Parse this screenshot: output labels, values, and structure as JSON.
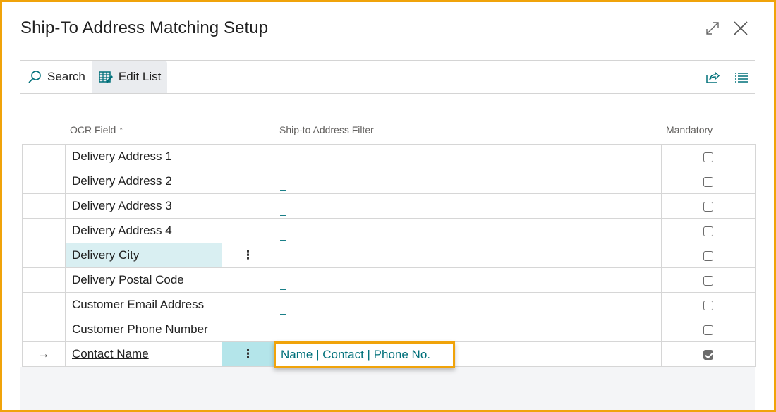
{
  "window": {
    "title": "Ship-To Address Matching Setup",
    "expand_icon": "expand-icon",
    "close_icon": "close-icon"
  },
  "toolbar": {
    "search_label": "Search",
    "edit_list_label": "Edit List",
    "share_icon": "share-icon",
    "list_view_icon": "list-view-icon"
  },
  "table": {
    "headers": {
      "ocr_field": "OCR Field",
      "sort_indicator": "↑",
      "filter": "Ship-to Address Filter",
      "mandatory": "Mandatory"
    },
    "rows": [
      {
        "ocr_field": "Delivery Address 1",
        "filter": "",
        "mandatory": false
      },
      {
        "ocr_field": "Delivery Address 2",
        "filter": "",
        "mandatory": false
      },
      {
        "ocr_field": "Delivery Address 3",
        "filter": "",
        "mandatory": false
      },
      {
        "ocr_field": "Delivery Address 4",
        "filter": "",
        "mandatory": false
      },
      {
        "ocr_field": "Delivery City",
        "filter": "",
        "mandatory": false
      },
      {
        "ocr_field": "Delivery Postal Code",
        "filter": "",
        "mandatory": false
      },
      {
        "ocr_field": "Customer Email Address",
        "filter": "",
        "mandatory": false
      },
      {
        "ocr_field": "Customer Phone Number",
        "filter": "",
        "mandatory": false
      },
      {
        "ocr_field": "Contact Name",
        "filter": "Name | Contact | Phone No.",
        "mandatory": true
      }
    ],
    "current_row_indicator": "→",
    "row_menu_glyph": "⋮"
  },
  "colors": {
    "highlight_border": "#f0a30a",
    "accent_teal": "#00707a",
    "selected_cell": "#b4e5ea",
    "hover_cell": "#d9eff2"
  }
}
